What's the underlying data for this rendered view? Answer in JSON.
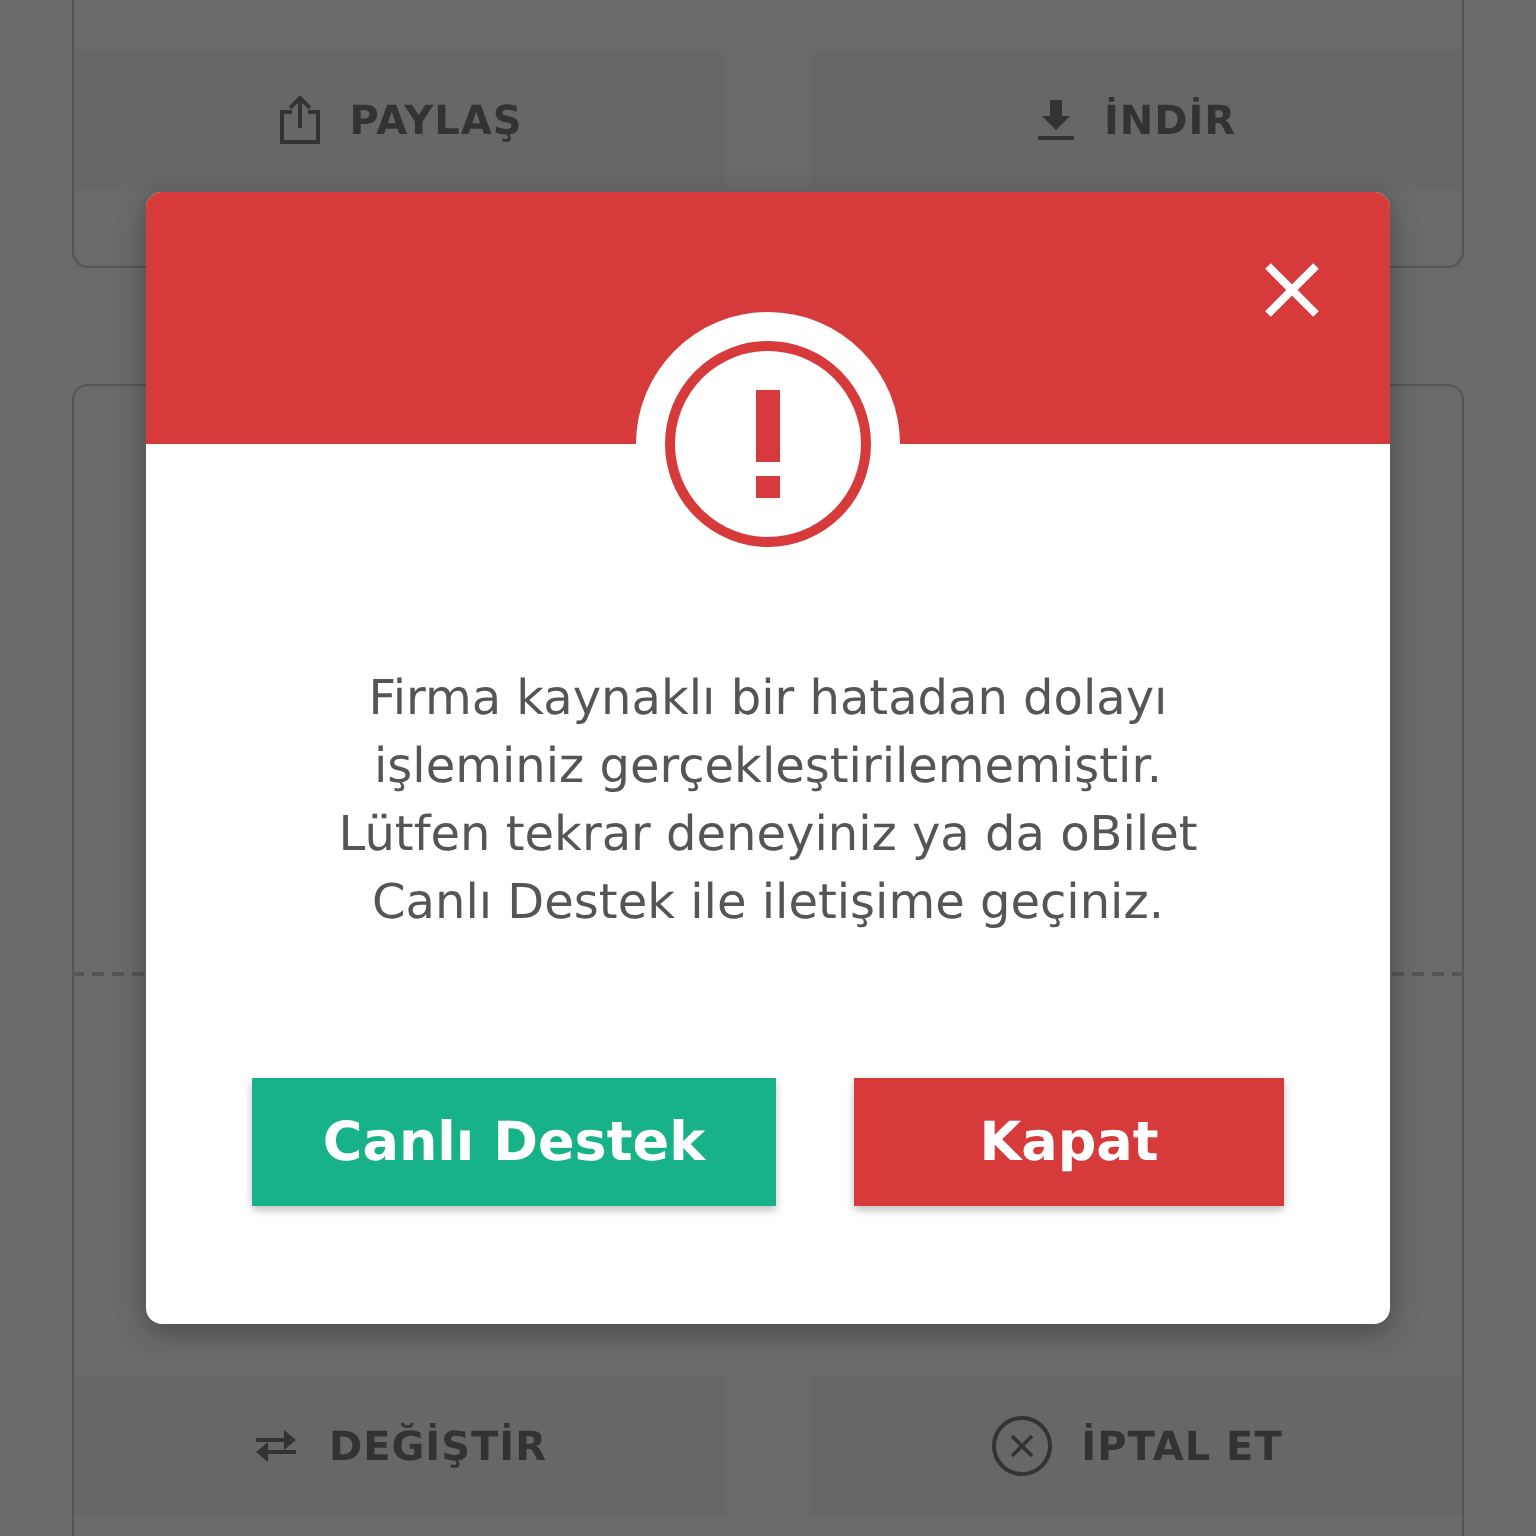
{
  "background": {
    "top_actions": [
      {
        "kind": "share",
        "label": "PAYLAŞ"
      },
      {
        "kind": "download",
        "label": "İNDİR"
      }
    ],
    "bottom_actions": [
      {
        "kind": "change",
        "label": "DEĞİŞTİR"
      },
      {
        "kind": "cancel",
        "label": "İPTAL ET"
      }
    ]
  },
  "dialog": {
    "message": "Firma kaynaklı bir hatadan dolayı işleminiz gerçekleştirilememiştir. Lütfen tekrar deneyiniz ya da oBilet Canlı Destek ile iletişime geçiniz.",
    "buttons": [
      {
        "kind": "support",
        "label": "Canlı Destek"
      },
      {
        "kind": "close",
        "label": "Kapat"
      }
    ]
  }
}
